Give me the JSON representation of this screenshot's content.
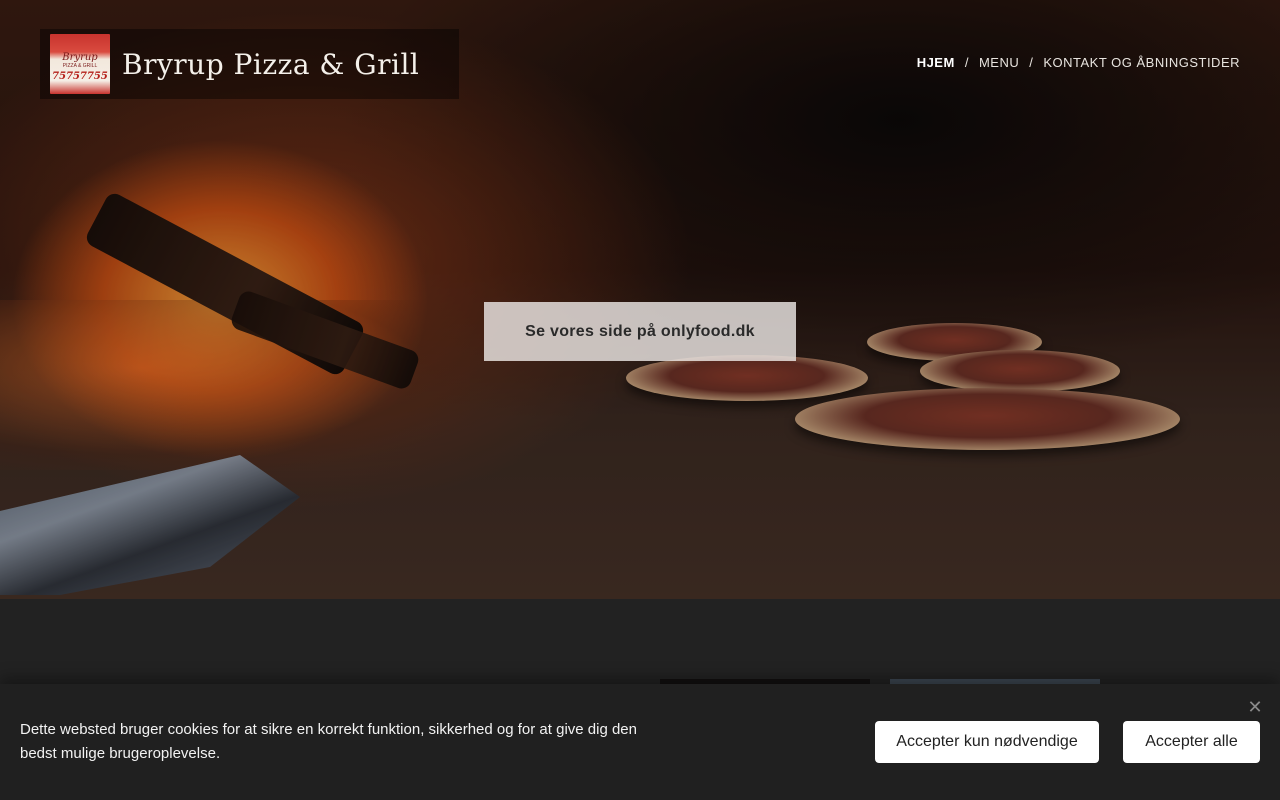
{
  "header": {
    "brand_title": "Bryrup Pizza & Grill",
    "logo": {
      "script_text": "Bryrup",
      "small_text": "PIZZA & GRILL",
      "phone": "75757755"
    }
  },
  "nav": {
    "items": [
      {
        "label": "HJEM",
        "active": true
      },
      {
        "label": "MENU",
        "active": false
      },
      {
        "label": "KONTAKT OG ÅBNINGSTIDER",
        "active": false
      }
    ],
    "separator": "/"
  },
  "hero": {
    "cta_label": "Se vores side på onlyfood.dk"
  },
  "cookie_banner": {
    "text": "Dette websted bruger cookies for at sikre en korrekt funktion, sikkerhed og for at give dig den bedst mulige brugeroplevelse.",
    "btn_necessary": "Accepter kun nødvendige",
    "btn_all": "Accepter alle",
    "close_icon": "close-icon"
  },
  "colors": {
    "page_bg": "#222222",
    "cookie_bg": "#202020",
    "button_bg": "#ffffff",
    "cta_bg": "#ebe6e4"
  }
}
